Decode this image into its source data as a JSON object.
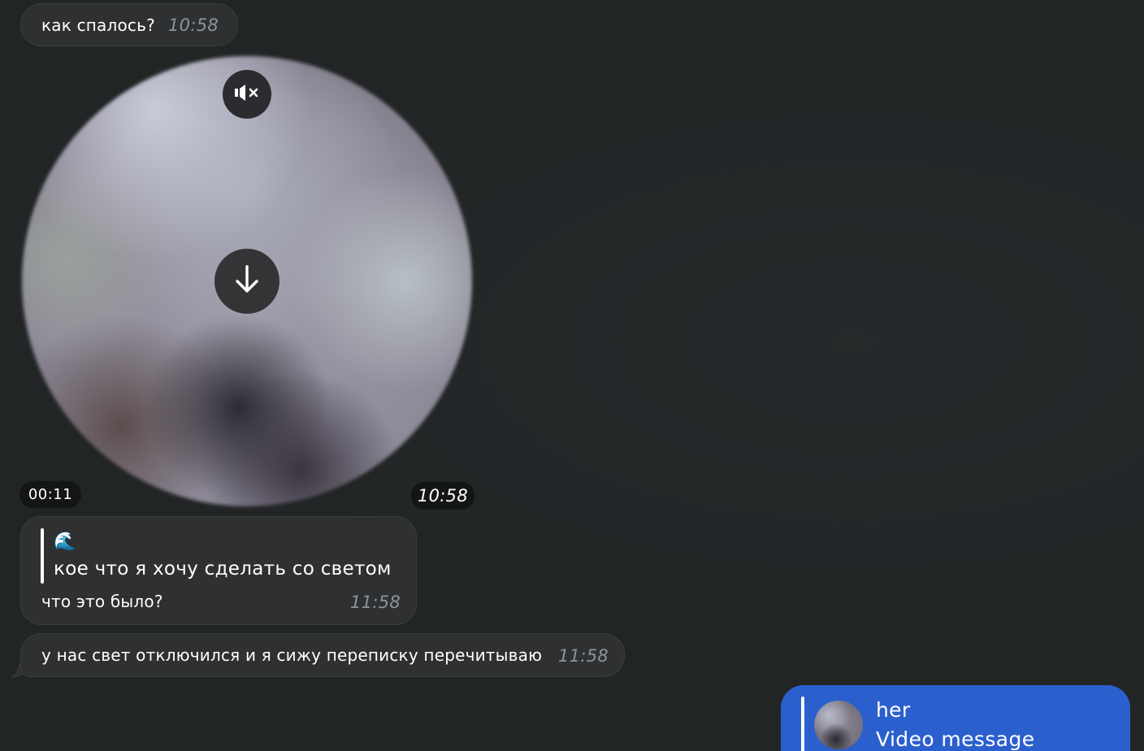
{
  "messages": {
    "m1": {
      "text": "как спалось?",
      "time": "10:58"
    },
    "video": {
      "duration": "00:11",
      "time": "10:58",
      "mute_icon": "speaker-muted-icon",
      "download_icon": "download-arrow-icon"
    },
    "m3": {
      "quote_emoji": "🌊",
      "quote_text": "кое что я хочу сделать со светом",
      "text": "что это было?",
      "time": "11:58"
    },
    "m4": {
      "text": "у нас свет отключился и я сижу переписку перечитываю",
      "time": "11:58"
    },
    "m5": {
      "reply_name": "her",
      "reply_type": "Video message"
    }
  },
  "colors": {
    "background": "#222526",
    "incoming_bubble": "#2f3031",
    "outgoing_bubble": "#2b5fce",
    "time_text": "#8e939a"
  }
}
